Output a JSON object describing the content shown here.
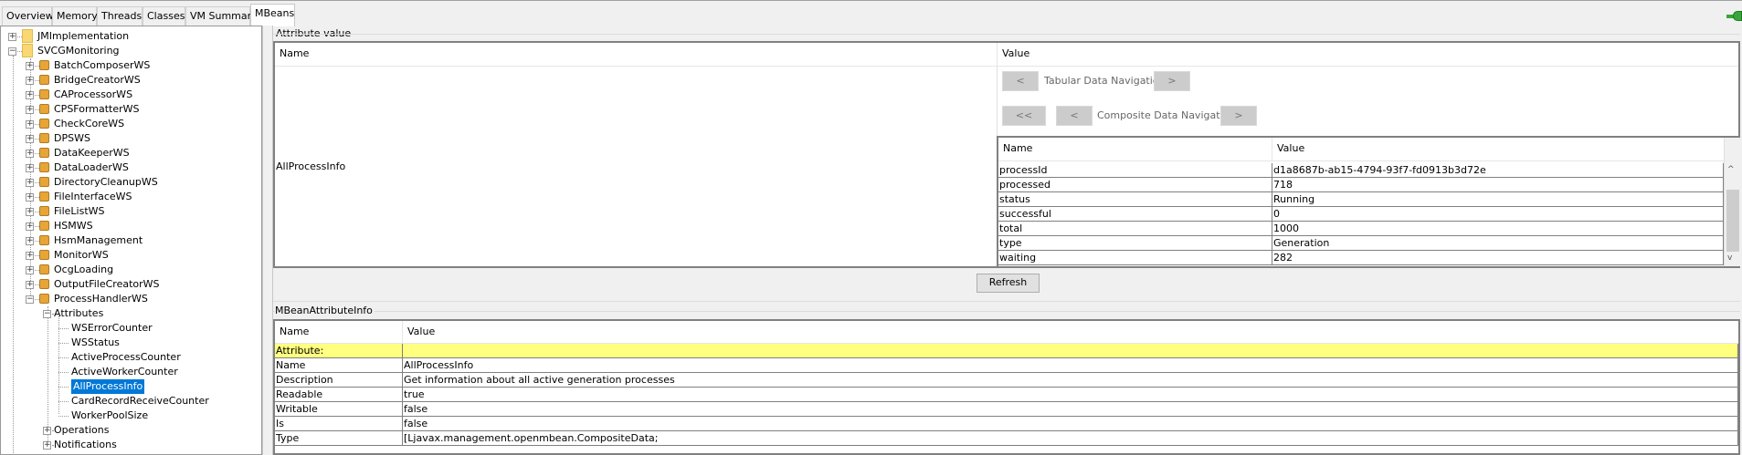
{
  "tabs": [
    {
      "label": "Overview"
    },
    {
      "label": "Memory"
    },
    {
      "label": "Threads"
    },
    {
      "label": "Classes"
    },
    {
      "label": "VM Summary"
    },
    {
      "label": "MBeans",
      "selected": true
    }
  ],
  "connection_icon": "connected-plug-icon",
  "colors": {
    "selection": "#0078d7",
    "highlight_row": "#ffff80",
    "connection": "#3aa53a"
  },
  "tree": {
    "roots": [
      {
        "label": "JMImplementation"
      },
      {
        "label": "SVCGMonitoring"
      }
    ],
    "beans": [
      "BatchComposerWS",
      "BridgeCreatorWS",
      "CAProcessorWS",
      "CPSFormatterWS",
      "CheckCoreWS",
      "DPSWS",
      "DataKeeperWS",
      "DataLoaderWS",
      "DirectoryCleanupWS",
      "FileInterfaceWS",
      "FileListWS",
      "HSMWS",
      "HsmManagement",
      "MonitorWS",
      "OcgLoading",
      "OutputFileCreatorWS",
      "ProcessHandlerWS"
    ],
    "attributes_label": "Attributes",
    "attributes": [
      "WSErrorCounter",
      "WSStatus",
      "ActiveProcessCounter",
      "ActiveWorkerCounter",
      "AllProcessInfo",
      "CardRecordReceiveCounter",
      "WorkerPoolSize"
    ],
    "selected_attribute": "AllProcessInfo",
    "operations_label": "Operations",
    "notifications_label": "Notifications"
  },
  "attribute_value": {
    "title": "Attribute value",
    "col_name": "Name",
    "col_value": "Value",
    "row_name": "AllProcessInfo",
    "tabular_nav": {
      "prev": "<",
      "label": "Tabular Data Navigation",
      "next": ">"
    },
    "composite_nav": {
      "first": "<<",
      "prev": "<",
      "label": "Composite Data Navigation",
      "next": ">"
    },
    "inner": {
      "col_name": "Name",
      "col_value": "Value",
      "rows": [
        [
          "processId",
          "d1a8687b-ab15-4794-93f7-fd0913b3d72e"
        ],
        [
          "processed",
          "718"
        ],
        [
          "status",
          "Running"
        ],
        [
          "successful",
          "0"
        ],
        [
          "total",
          "1000"
        ],
        [
          "type",
          "Generation"
        ],
        [
          "waiting",
          "282"
        ]
      ]
    }
  },
  "refresh_label": "Refresh",
  "mbean_info": {
    "title": "MBeanAttributeInfo",
    "col_name": "Name",
    "col_value": "Value",
    "rows": [
      [
        "Attribute:",
        ""
      ],
      [
        "Name",
        "AllProcessInfo"
      ],
      [
        "Description",
        "Get information about all active generation processes"
      ],
      [
        "Readable",
        "true"
      ],
      [
        "Writable",
        "false"
      ],
      [
        "Is",
        "false"
      ],
      [
        "Type",
        "[Ljavax.management.openmbean.CompositeData;"
      ]
    ]
  }
}
